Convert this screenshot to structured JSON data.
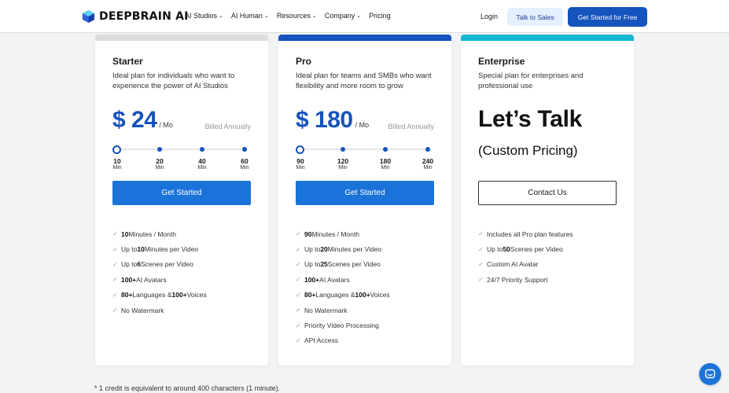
{
  "header": {
    "logo_text": "DEEPBRAIN AI",
    "nav": [
      {
        "label": "AI Studios",
        "has_dropdown": true
      },
      {
        "label": "AI Human",
        "has_dropdown": true
      },
      {
        "label": "Resources",
        "has_dropdown": true
      },
      {
        "label": "Company",
        "has_dropdown": true
      },
      {
        "label": "Pricing",
        "has_dropdown": false
      }
    ],
    "login_label": "Login",
    "talk_to_sales_label": "Talk to Sales",
    "get_started_label": "Get Started for Free"
  },
  "plans": [
    {
      "name": "Starter",
      "description": "Ideal plan for individuals who want to experience the power of AI Studios",
      "price": "$ 24",
      "per": "/ Mo",
      "billing": "Billed Annually",
      "accent": "#dcdcdc",
      "slider": {
        "options": [
          "10",
          "20",
          "40",
          "60"
        ],
        "unit": "Min",
        "selected_index": 0
      },
      "cta_label": "Get Started",
      "features": [
        {
          "bold": "10",
          "text": " Minutes / Month",
          "prefix": ""
        },
        {
          "prefix": "Up to ",
          "bold": "10",
          "text": " Minutes per Video"
        },
        {
          "prefix": "Up to ",
          "bold": "6",
          "text": " Scenes per Video"
        },
        {
          "prefix": "",
          "bold": "100+",
          "text": " AI Avatars"
        },
        {
          "prefix": "",
          "bold": "80+",
          "text": " Languages & ",
          "bold2": "100+",
          "text2": " Voices"
        },
        {
          "prefix": "",
          "bold": "",
          "text": "No Watermark"
        }
      ]
    },
    {
      "name": "Pro",
      "description": "Ideal plan for teams and SMBs who want flexibility and more room to grow",
      "price": "$ 180",
      "per": "/ Mo",
      "billing": "Billed Annually",
      "accent": "#1553bd",
      "slider": {
        "options": [
          "90",
          "120",
          "180",
          "240"
        ],
        "unit": "Min",
        "selected_index": 0
      },
      "cta_label": "Get Started",
      "features": [
        {
          "prefix": "",
          "bold": "90",
          "text": " Minutes / Month"
        },
        {
          "prefix": "Up to ",
          "bold": "20",
          "text": " Minutes per Video"
        },
        {
          "prefix": "Up to ",
          "bold": "25",
          "text": " Scenes per Video"
        },
        {
          "prefix": "",
          "bold": "100+",
          "text": " AI Avatars"
        },
        {
          "prefix": "",
          "bold": "80+",
          "text": " Languages & ",
          "bold2": "100+",
          "text2": " Voices"
        },
        {
          "prefix": "",
          "bold": "",
          "text": "No Watermark"
        },
        {
          "prefix": "",
          "bold": "",
          "text": "Priority Video Processing"
        },
        {
          "prefix": "",
          "bold": "",
          "text": "API Access"
        }
      ]
    },
    {
      "name": "Enterprise",
      "description": "Special plan for enterprises and professional use",
      "headline": "Let’s Talk",
      "subheadline": "(Custom Pricing)",
      "accent": "#14b8d4",
      "cta_label": "Contact Us",
      "features": [
        {
          "prefix": "",
          "bold": "",
          "text": "Includes all Pro plan features"
        },
        {
          "prefix": "Up to ",
          "bold": "50",
          "text": " Scenes per Video"
        },
        {
          "prefix": "",
          "bold": "",
          "text": "Custom AI Avatar"
        },
        {
          "prefix": "",
          "bold": "",
          "text": "24/7 Priority Support"
        }
      ]
    }
  ],
  "footnote": "* 1 credit is equivalent to around 400 characters (1 minute).",
  "colors": {
    "brand_blue": "#1553bd",
    "cta_blue": "#1a73d9",
    "talk_bg": "#e4efff"
  },
  "icons": {
    "check": "check-icon",
    "chevron": "chevron-down-icon",
    "chat": "chat-icon"
  }
}
